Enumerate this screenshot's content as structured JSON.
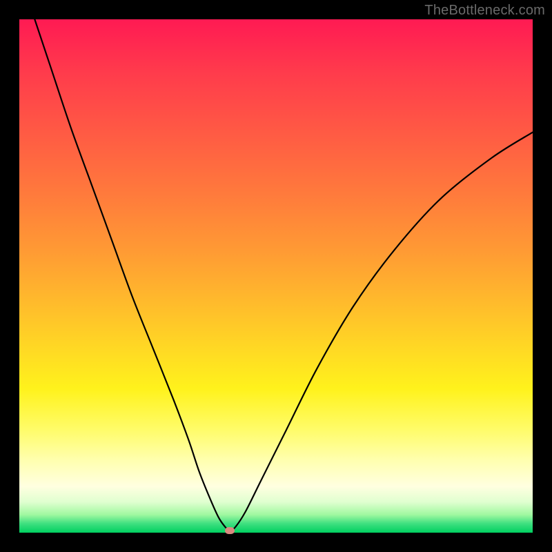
{
  "watermark": "TheBottleneck.com",
  "colors": {
    "frame": "#000000",
    "curve": "#000000",
    "marker": "#d98a80"
  },
  "chart_data": {
    "type": "line",
    "title": "",
    "xlabel": "",
    "ylabel": "",
    "xlim": [
      0,
      100
    ],
    "ylim": [
      0,
      100
    ],
    "grid": false,
    "series": [
      {
        "name": "bottleneck-curve",
        "x": [
          3,
          6,
          10,
          14,
          18,
          22,
          26,
          30,
          33,
          35,
          37,
          38.8,
          40.2,
          41,
          42,
          44,
          47,
          52,
          58,
          65,
          73,
          82,
          92,
          100
        ],
        "y": [
          100,
          91,
          79,
          68,
          57,
          46,
          36,
          26,
          18,
          12,
          7,
          3,
          1,
          0.4,
          1,
          4,
          10,
          20,
          32,
          44,
          55,
          65,
          73,
          78
        ]
      }
    ],
    "annotations": [
      {
        "name": "optimum-marker",
        "x": 41,
        "y": 0.4
      }
    ]
  }
}
